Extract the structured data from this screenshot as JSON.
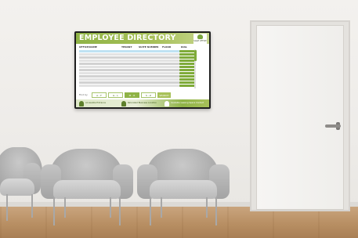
{
  "directory": {
    "title": "EMPLOYEE DIRECTORY",
    "logo_text": "SAGE\nOFFICE",
    "columns": [
      "OFFICE/NAME",
      "TENANT",
      "SUITE NUMBER",
      "FLOOR",
      "DIAL"
    ],
    "pager_label": "Find by",
    "pager_buttons": [
      "A - F",
      "G - L",
      "M - R",
      "S - Z",
      "SEARCH"
    ],
    "footer": [
      "Accessible Entrance",
      "Relocated Business Location",
      "Available Leasing Space Contact"
    ]
  },
  "colors": {
    "accent_green": "#8fb346",
    "selected_row": "#bfe2f3",
    "chair_gray": "#b5b5b5",
    "floor_wood": "#b88f63"
  }
}
